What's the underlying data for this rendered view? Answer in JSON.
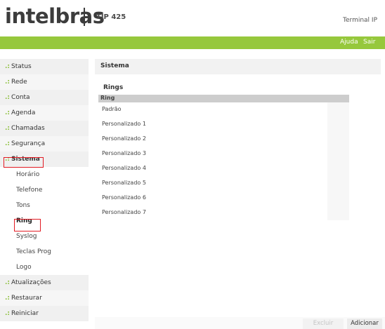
{
  "header": {
    "brand": "intelbras",
    "model": "TIP 425",
    "terminal_label": "Terminal IP"
  },
  "topbar": {
    "help": "Ajuda",
    "logout": "Sair"
  },
  "sidebar": {
    "items": [
      {
        "label": "Status",
        "level": "main"
      },
      {
        "label": "Rede",
        "level": "main"
      },
      {
        "label": "Conta",
        "level": "main"
      },
      {
        "label": "Agenda",
        "level": "main"
      },
      {
        "label": "Chamadas",
        "level": "main"
      },
      {
        "label": "Segurança",
        "level": "main"
      },
      {
        "label": "Sistema",
        "level": "main",
        "selected": true
      },
      {
        "label": "Horário",
        "level": "sub"
      },
      {
        "label": "Telefone",
        "level": "sub"
      },
      {
        "label": "Tons",
        "level": "sub"
      },
      {
        "label": "Ring",
        "level": "sub",
        "selected": true
      },
      {
        "label": "Syslog",
        "level": "sub"
      },
      {
        "label": "Teclas Prog",
        "level": "sub"
      },
      {
        "label": "Logo",
        "level": "sub"
      },
      {
        "label": "Atualizações",
        "level": "main"
      },
      {
        "label": "Restaurar",
        "level": "main"
      },
      {
        "label": "Reiniciar",
        "level": "main"
      }
    ]
  },
  "main": {
    "section_title": "Sistema",
    "subtitle": "Rings",
    "table": {
      "column": "Ring",
      "rows": [
        "Padrão",
        "Personalizado 1",
        "Personalizado 2",
        "Personalizado 3",
        "Personalizado 4",
        "Personalizado 5",
        "Personalizado 6",
        "Personalizado 7"
      ]
    },
    "buttons": {
      "delete": "Excluir",
      "add": "Adicionar"
    }
  },
  "colors": {
    "accent_green": "#96c83c",
    "highlight_red": "#e21b23"
  }
}
